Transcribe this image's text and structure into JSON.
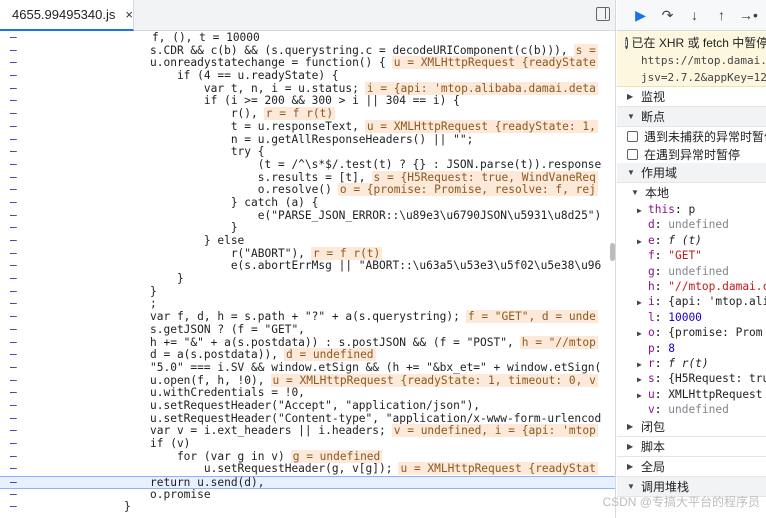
{
  "tab": {
    "filename": "4655.99495340.js",
    "close": "×"
  },
  "code_lines": [
    {
      "t": "f, (), t = 10000",
      "c": "tail"
    },
    {
      "t": "s.CDR && c(b) && (s.querystring.c = decodeURIComponent(c(b))),",
      "v": "s ="
    },
    {
      "t": "u.onreadystatechange = function() {",
      "v": "u = XMLHttpRequest {readyState"
    },
    {
      "t": "    if (4 == u.readyState) {"
    },
    {
      "t": "        var t, n, i = u.status;",
      "v": "i = {api: 'mtop.alibaba.damai.deta"
    },
    {
      "t": "        if (i >= 200 && 300 > i || 304 == i) {"
    },
    {
      "t": "            r(),",
      "v": "r = f r(t)"
    },
    {
      "t": "            t = u.responseText,",
      "v": "u = XMLHttpRequest {readyState: 1,"
    },
    {
      "t": "            n = u.getAllResponseHeaders() || \"\";"
    },
    {
      "t": "            try {"
    },
    {
      "t": "                (t = /^\\s*$/.test(t) ? {} : JSON.parse(t)).response"
    },
    {
      "t": "                s.results = [t],",
      "v": "s = {H5Request: true, WindVaneReq"
    },
    {
      "t": "                o.resolve()",
      "v": "o = {promise: Promise, resolve: f, rej"
    },
    {
      "t": "            } catch (a) {"
    },
    {
      "t": "                e(\"PARSE_JSON_ERROR::\\u89e3\\u6790JSON\\u5931\\u8d25\")"
    },
    {
      "t": "            }"
    },
    {
      "t": "        } else"
    },
    {
      "t": "            r(\"ABORT\"),",
      "v": "r = f r(t)"
    },
    {
      "t": "            e(s.abortErrMsg || \"ABORT::\\u63a5\\u53e3\\u5f02\\u5e38\\u96"
    },
    {
      "t": "    }"
    },
    {
      "t": "}"
    },
    {
      "t": ";"
    },
    {
      "t": "var f, d, h = s.path + \"?\" + a(s.querystring);",
      "v": "f = \"GET\", d = unde"
    },
    {
      "t": "s.getJSON ? (f = \"GET\","
    },
    {
      "t": "h += \"&\" + a(s.postdata)) : s.postJSON && (f = \"POST\",",
      "v": "h = \"//mtop"
    },
    {
      "t": "d = a(s.postdata)),",
      "v": "d = undefined"
    },
    {
      "t": "\"5.0\" === i.SV && window.etSign && (h += \"&bx_et=\" + window.etSign("
    },
    {
      "t": "u.open(f, h, !0),",
      "v": "u = XMLHttpRequest {readyState: 1, timeout: 0, v"
    },
    {
      "t": "u.withCredentials = !0,"
    },
    {
      "t": "u.setRequestHeader(\"Accept\", \"application/json\"),"
    },
    {
      "t": "u.setRequestHeader(\"Content-type\", \"application/x-www-form-urlencod"
    },
    {
      "t": "var v = i.ext_headers || i.headers;",
      "v": "v = undefined, i = {api: 'mtop"
    },
    {
      "t": "if (v)"
    },
    {
      "t": "    for (var g in v)",
      "v": "g = undefined"
    },
    {
      "t": "        u.setRequestHeader(g, v[g]);",
      "v": "u = XMLHttpRequest {readyStat"
    },
    {
      "t": "return u.send(d),"
    },
    {
      "t": "o.promise"
    },
    {
      "t": "}"
    }
  ],
  "sidebar": {
    "pause_message": "已在 XHR 或 fetch 中暂停",
    "pause_url_1": "https://mtop.damai.",
    "pause_url_2": "jsv=2.7.2&appKey=12",
    "watch": "监视",
    "breakpoints": "断点",
    "pause_uncaught": "遇到未捕获的异常时暂停",
    "pause_caught": "在遇到异常时暂停",
    "scope": "作用域",
    "local": "本地",
    "vars": [
      {
        "tri": true,
        "name": "this",
        "val": "p",
        "kind": "val"
      },
      {
        "tri": false,
        "name": "d",
        "val": "undefined",
        "kind": "und"
      },
      {
        "tri": true,
        "name": "e",
        "val": "f (t)",
        "kind": "fn"
      },
      {
        "tri": false,
        "name": "f",
        "val": "\"GET\"",
        "kind": "str"
      },
      {
        "tri": false,
        "name": "g",
        "val": "undefined",
        "kind": "und"
      },
      {
        "tri": false,
        "name": "h",
        "val": "\"//mtop.damai.c",
        "kind": "str"
      },
      {
        "tri": true,
        "name": "i",
        "val": "{api: 'mtop.ali",
        "kind": "val"
      },
      {
        "tri": false,
        "name": "l",
        "val": "10000",
        "kind": "num"
      },
      {
        "tri": true,
        "name": "o",
        "val": "{promise: Prom",
        "kind": "val"
      },
      {
        "tri": false,
        "name": "p",
        "val": "8",
        "kind": "num"
      },
      {
        "tri": true,
        "name": "r",
        "val": "f r(t)",
        "kind": "fn"
      },
      {
        "tri": true,
        "name": "s",
        "val": "{H5Request: tru",
        "kind": "val"
      },
      {
        "tri": true,
        "name": "u",
        "val": "XMLHttpRequest",
        "kind": "val"
      },
      {
        "tri": false,
        "name": "v",
        "val": "undefined",
        "kind": "und"
      }
    ],
    "closure": "闭包",
    "script": "脚本",
    "global": "全局",
    "call_stack": "调用堆栈"
  },
  "watermark": "CSDN @专搞大平台的程序员",
  "colors": {
    "accent": "#1a73e8",
    "scope_value_bg": "#fde9d9",
    "paused_bg": "#fef7e0"
  }
}
